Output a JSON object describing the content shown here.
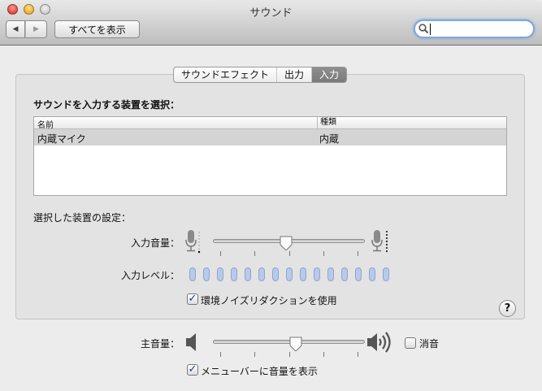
{
  "window": {
    "title": "サウンド"
  },
  "toolbar": {
    "back": "◀",
    "forward": "▶",
    "show_all": "すべてを表示",
    "search_value": "",
    "search_icon": "search-icon"
  },
  "tabs": [
    {
      "label": "サウンドエフェクト"
    },
    {
      "label": "出力"
    },
    {
      "label": "入力",
      "selected": true
    }
  ],
  "input": {
    "device_heading": "サウンドを入力する装置を選択：",
    "columns": [
      "名前",
      "種類"
    ],
    "rows": [
      {
        "name": "内蔵マイク",
        "type": "内蔵",
        "selected": true
      }
    ],
    "settings_heading": "選択した装置の設定：",
    "volume_label": "入力音量：",
    "volume": 0.48,
    "level_label": "入力レベル：",
    "level_segments": 15,
    "level_active": 0,
    "noise_reduction_label": "環境ノイズリダクションを使用",
    "noise_reduction": true
  },
  "help": "?",
  "output": {
    "volume_label": "主音量：",
    "volume": 0.55,
    "mute_label": "消音",
    "muted": false,
    "menubar_label": "メニューバーに音量を表示",
    "menubar": true
  },
  "colors": {
    "accent": "#7fa9dc",
    "level": "#b8c9ea",
    "selected_tab": "#858585"
  }
}
